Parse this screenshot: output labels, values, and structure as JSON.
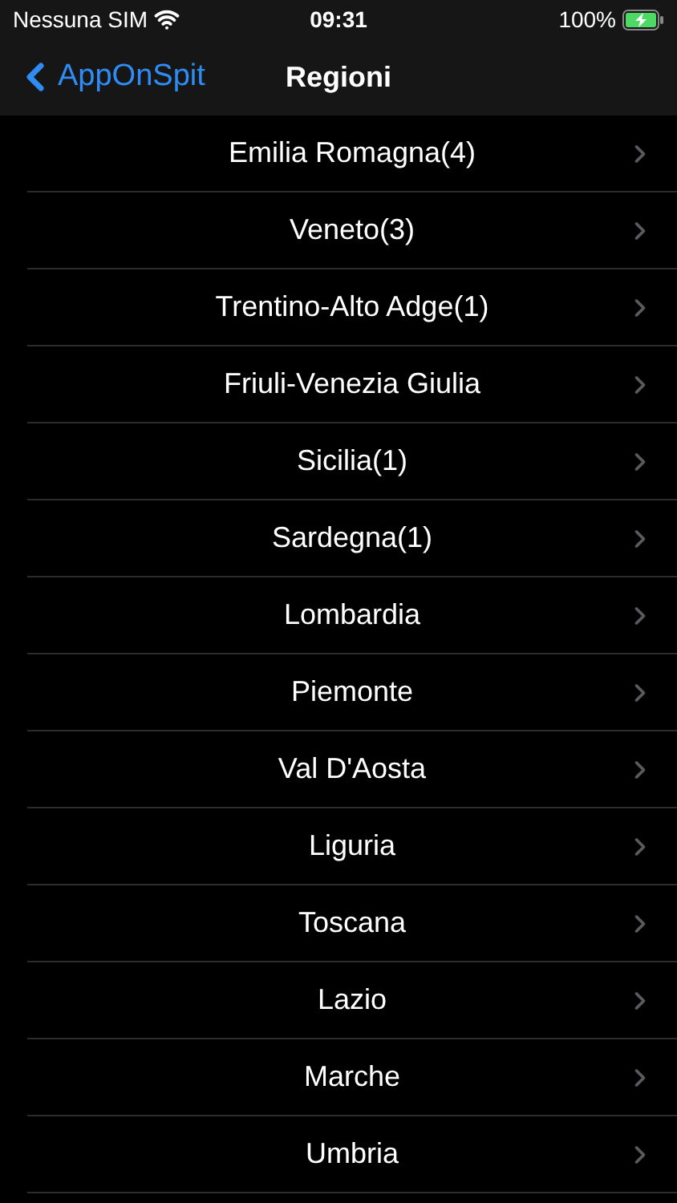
{
  "status_bar": {
    "carrier": "Nessuna SIM",
    "time": "09:31",
    "battery": "100%",
    "charging": true
  },
  "nav_bar": {
    "back": "AppOnSpit",
    "title": "Regioni"
  },
  "regions": [
    "Emilia Romagna(4)",
    "Veneto(3)",
    "Trentino-Alto Adge(1)",
    "Friuli-Venezia Giulia",
    "Sicilia(1)",
    "Sardegna(1)",
    "Lombardia",
    "Piemonte",
    "Val D'Aosta",
    "Liguria",
    "Toscana",
    "Lazio",
    "Marche",
    "Umbria"
  ]
}
